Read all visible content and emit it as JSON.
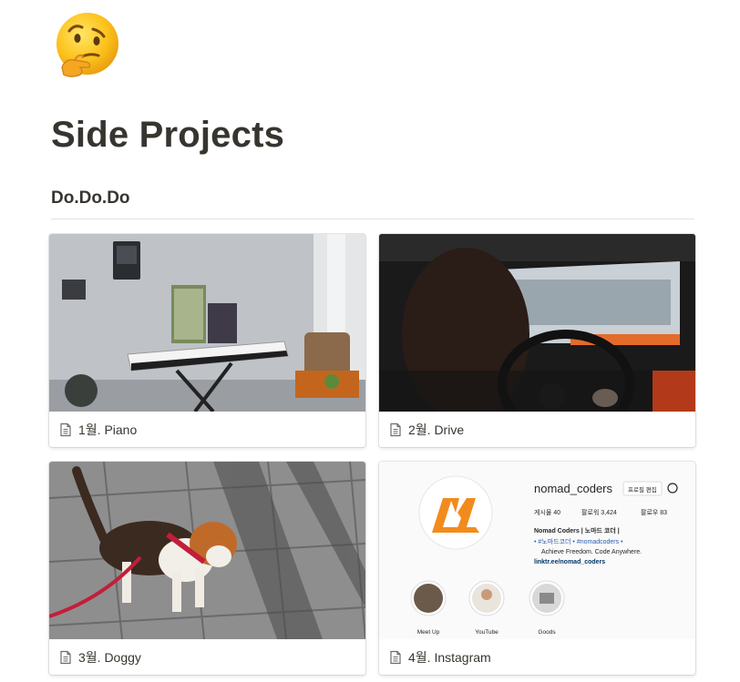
{
  "page": {
    "icon": "thinking-face-emoji",
    "title": "Side Projects"
  },
  "section": {
    "heading": "Do.Do.Do"
  },
  "gallery": {
    "cards": [
      {
        "label": "1월. Piano",
        "icon": "page-document-icon",
        "cover": "photo of a white digital piano on a stand against a grey wall"
      },
      {
        "label": "2월. Drive",
        "icon": "page-document-icon",
        "cover": "photo from inside a car of a driver at the steering wheel"
      },
      {
        "label": "3월. Doggy",
        "icon": "page-document-icon",
        "cover": "photo of a beagle dog on a red leash on paving stones"
      },
      {
        "label": "4월. Instagram",
        "icon": "page-document-icon",
        "cover": "screenshot of an instagram profile"
      }
    ]
  },
  "instagram": {
    "username": "nomad_coders",
    "edit_button": "프로필 편집",
    "posts": "게시물 40",
    "followers": "팔로워 3,424",
    "following": "팔로우 83",
    "bio_name": "Nomad Coders | 노마드 코더 |",
    "bio_tags": "• #노마드코더 • #nomadcoders •",
    "bio_line": "Achieve Freedom. Code Anywhere.",
    "bio_link": "linktr.ee/nomad_coders",
    "highlights": [
      "Meet Up",
      "YouTube",
      "Goods"
    ],
    "brand_color": "#f28b1e"
  }
}
